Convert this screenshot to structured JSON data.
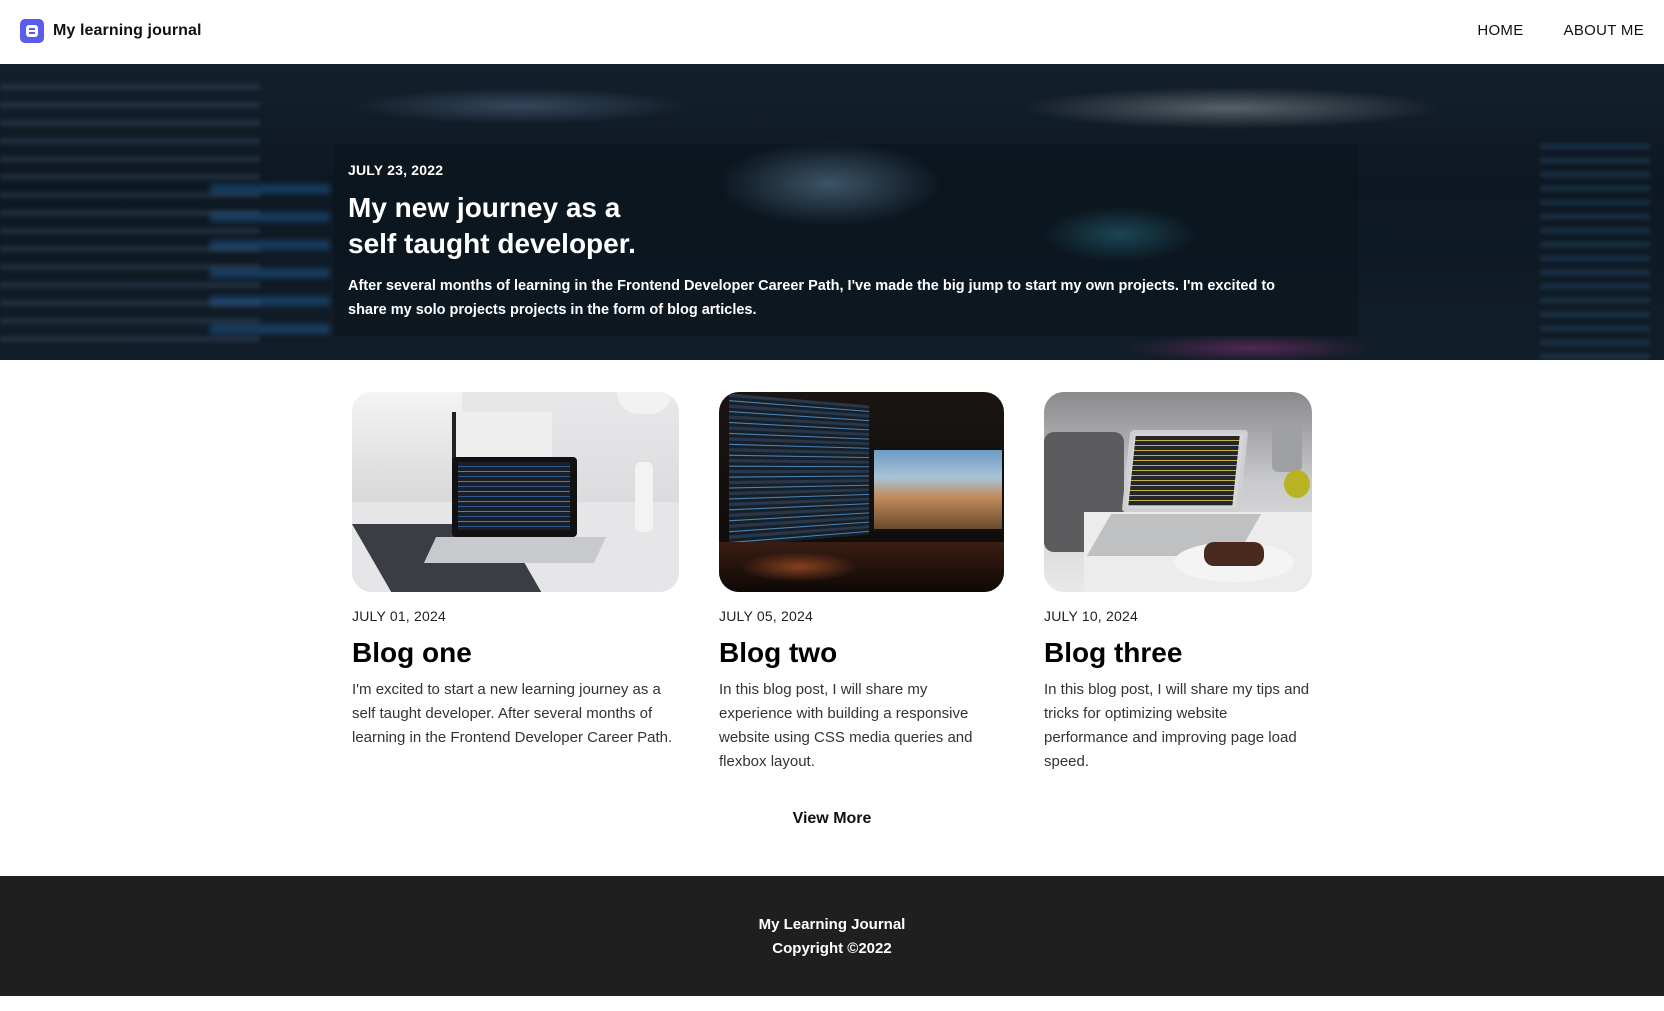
{
  "header": {
    "brand": {
      "icon": "blogger-icon",
      "icon_color": "#5b5bf0",
      "title": "My learning journal"
    },
    "nav": [
      {
        "label": "HOME"
      },
      {
        "label": "ABOUT ME"
      }
    ]
  },
  "hero": {
    "date": "JULY 23, 2022",
    "title": "My new journey as a self taught developer.",
    "description": "After several months of learning in the Frontend Developer Career Path, I've made the big jump to start my own projects. I'm excited to share my solo projects projects in the form of blog articles."
  },
  "posts": [
    {
      "date": "JULY 01, 2024",
      "title": "Blog one",
      "excerpt": "I'm excited to start a new learning journey as a self taught developer. After several months of learning in the Frontend Developer Career Path.",
      "image": "laptop-on-desk-image"
    },
    {
      "date": "JULY 05, 2024",
      "title": "Blog two",
      "excerpt": "In this blog post, I will share my experience with building a responsive website using CSS media queries and flexbox layout.",
      "image": "dual-monitor-setup-image"
    },
    {
      "date": "JULY 10, 2024",
      "title": "Blog three",
      "excerpt": "In this blog post, I will share my tips and tricks for optimizing website performance and improving page load speed.",
      "image": "laptop-with-cake-image"
    }
  ],
  "view_more": {
    "label": "View More"
  },
  "footer": {
    "line1": "My Learning Journal",
    "line2": "Copyright ©2022",
    "background": "#1f1f20"
  }
}
